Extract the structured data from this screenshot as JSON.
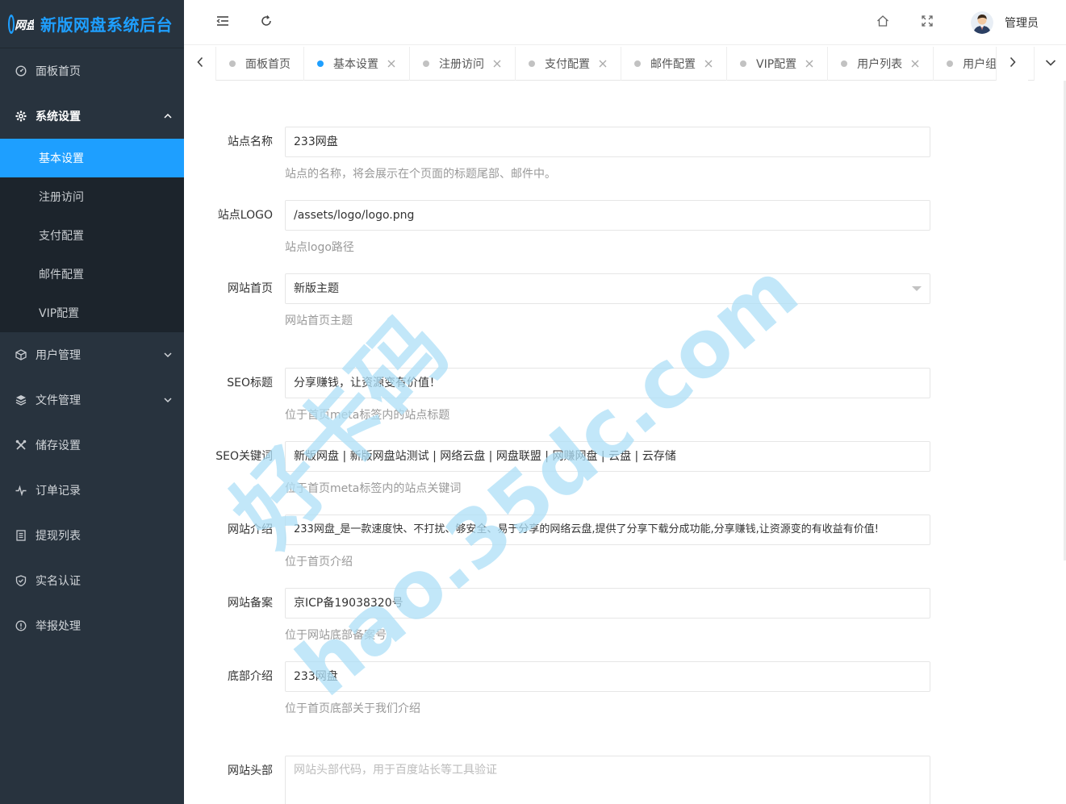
{
  "app": {
    "title": "新版网盘系统后台",
    "logo_text": "网盘"
  },
  "sidebar": {
    "items": [
      {
        "label": "面板首页",
        "icon": "dashboard-icon"
      },
      {
        "label": "系统设置",
        "icon": "gear-icon",
        "expanded": true,
        "children": [
          {
            "label": "基本设置",
            "active": true
          },
          {
            "label": "注册访问"
          },
          {
            "label": "支付配置"
          },
          {
            "label": "邮件配置"
          },
          {
            "label": "VIP配置"
          }
        ]
      },
      {
        "label": "用户管理",
        "icon": "cube-icon"
      },
      {
        "label": "文件管理",
        "icon": "layers-icon"
      },
      {
        "label": "储存设置",
        "icon": "tools-icon"
      },
      {
        "label": "订单记录",
        "icon": "pulse-icon"
      },
      {
        "label": "提现列表",
        "icon": "list-icon"
      },
      {
        "label": "实名认证",
        "icon": "shield-check-icon"
      },
      {
        "label": "举报处理",
        "icon": "alert-circle-icon"
      }
    ]
  },
  "header": {
    "user_name": "管理员"
  },
  "tabs": [
    {
      "label": "面板首页",
      "closable": false
    },
    {
      "label": "基本设置",
      "closable": true,
      "active": true
    },
    {
      "label": "注册访问",
      "closable": true
    },
    {
      "label": "支付配置",
      "closable": true
    },
    {
      "label": "邮件配置",
      "closable": true
    },
    {
      "label": "VIP配置",
      "closable": true
    },
    {
      "label": "用户列表",
      "closable": true
    },
    {
      "label": "用户组管",
      "closable": false
    }
  ],
  "form": {
    "site_name": {
      "label": "站点名称",
      "value": "233网盘",
      "hint": "站点的名称，将会展示在个页面的标题尾部、邮件中。"
    },
    "site_logo": {
      "label": "站点LOGO",
      "value": "/assets/logo/logo.png",
      "hint": "站点logo路径"
    },
    "home_theme": {
      "label": "网站首页",
      "value": "新版主题",
      "hint": "网站首页主题"
    },
    "seo_title": {
      "label": "SEO标题",
      "value": "分享赚钱，让资源变有价值！",
      "hint": "位于首页meta标签内的站点标题"
    },
    "seo_keywords": {
      "label": "SEO关键词",
      "value": "新版网盘 | 新版网盘站测试 | 网络云盘 | 网盘联盟 | 网赚网盘 | 云盘 | 云存储",
      "hint": "位于首页meta标签内的站点关键词"
    },
    "site_intro": {
      "label": "网站介绍",
      "value": "233网盘_是一款速度快、不打扰、够安全、易于分享的网络云盘,提供了分享下载分成功能,分享赚钱,让资源变的有收益有价值!",
      "hint": "位于首页介绍"
    },
    "icp": {
      "label": "网站备案",
      "value": "京ICP备19038320号",
      "hint": "位于网站底部备案号"
    },
    "footer_intro": {
      "label": "底部介绍",
      "value": "233网盘",
      "hint": "位于首页底部关于我们介绍"
    },
    "site_header": {
      "label": "网站头部",
      "placeholder": "网站头部代码，用于百度站长等工具验证"
    }
  },
  "watermark": {
    "line1": "好卡码",
    "line2": "hao.35dc.com"
  },
  "colors": {
    "accent": "#1e9fff",
    "sidebar_bg": "#28333e",
    "submenu_bg": "#1c242c",
    "watermark": "#aee0f7"
  }
}
